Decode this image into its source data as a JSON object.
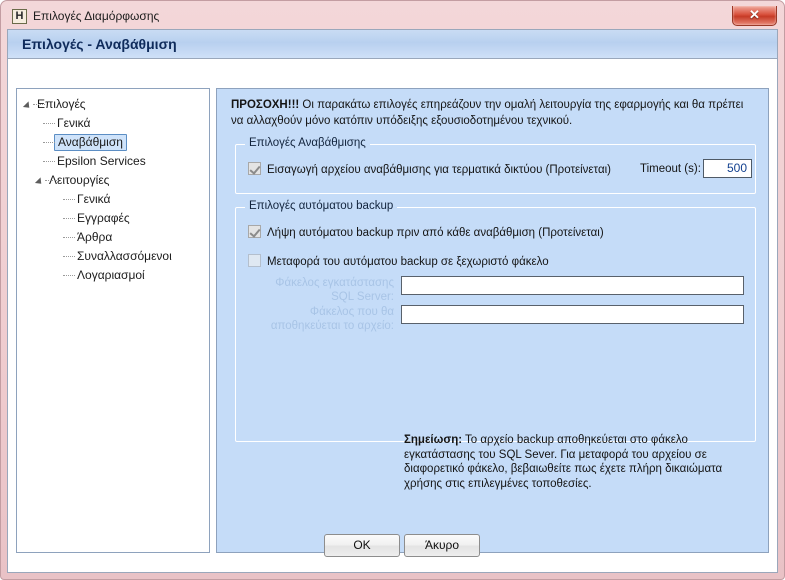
{
  "window": {
    "title": "Επιλογές Διαμόρφωσης",
    "app_icon": "H",
    "close_icon": "✕",
    "header_title": "Επιλογές - Αναβάθμιση"
  },
  "tree": {
    "nodes": [
      {
        "label": "Επιλογές",
        "level": 0,
        "expanded": true,
        "selected": false
      },
      {
        "label": "Γενικά",
        "level": 1,
        "selected": false
      },
      {
        "label": "Αναβάθμιση",
        "level": 1,
        "selected": true
      },
      {
        "label": "Epsilon Services",
        "level": 1,
        "selected": false
      },
      {
        "label": "Λειτουργίες",
        "level": 1,
        "expanded": true,
        "selected": false
      },
      {
        "label": "Γενικά",
        "level": 2,
        "selected": false
      },
      {
        "label": "Εγγραφές",
        "level": 2,
        "selected": false
      },
      {
        "label": "Άρθρα",
        "level": 2,
        "selected": false
      },
      {
        "label": "Συναλλασσόμενοι",
        "level": 2,
        "selected": false
      },
      {
        "label": "Λογαριασμοί",
        "level": 2,
        "selected": false
      }
    ]
  },
  "content": {
    "warning_bold": "ΠΡΟΣΟΧΗ!!!",
    "warning_text": " Οι παρακάτω επιλογές επηρεάζουν την ομαλή λειτουργία της εφαρμογής και θα πρέπει να αλλαχθούν μόνο κατόπιν υπόδειξης εξουσιοδοτημένου τεχνικού.",
    "group1": {
      "title": "Επιλογές Αναβάθμισης",
      "checkbox_label": "Εισαγωγή αρχείου αναβάθμισης για τερματικά δικτύου (Προτείνεται)",
      "checkbox_checked": true,
      "timeout_label": "Timeout (s):",
      "timeout_value": "500"
    },
    "group2": {
      "title": "Επιλογές αυτόματου backup",
      "checkbox1_label": "Λήψη αυτόματου backup πριν από κάθε αναβάθμιση (Προτείνεται)",
      "checkbox1_checked": true,
      "checkbox2_label": "Μεταφορά του αυτόματου backup σε ξεχωριστό φάκελο",
      "checkbox2_checked": false,
      "field1_label_line1": "Φάκελος εγκατάστασης",
      "field1_label_line2": "SQL Server:",
      "field1_value": "",
      "field2_label_line1": "Φάκελος που θα",
      "field2_label_line2": "αποθηκεύεται το αρχείο:",
      "field2_value": "",
      "note_bold": "Σημείωση:",
      "note_text": " Το αρχείο backup αποθηκεύεται στο φάκελο εγκατάστασης του SQL Sever. Για μεταφορά του αρχείου σε διαφορετικό φάκελο, βεβαιωθείτε πως έχετε πλήρη δικαιώματα χρήσης στις επιλεγμένες τοποθεσίες."
    }
  },
  "footer": {
    "ok_label": "OK",
    "cancel_label": "Άκυρο"
  },
  "colors": {
    "frame": "#f0cdd0",
    "content_panel": "#c5dcf8",
    "header_gradient_top": "#c9dcf4",
    "accent_text": "#0f2b5b",
    "value_text": "#13418f",
    "disabled_label": "#a8c4e6",
    "close_button": "#c63a26"
  }
}
